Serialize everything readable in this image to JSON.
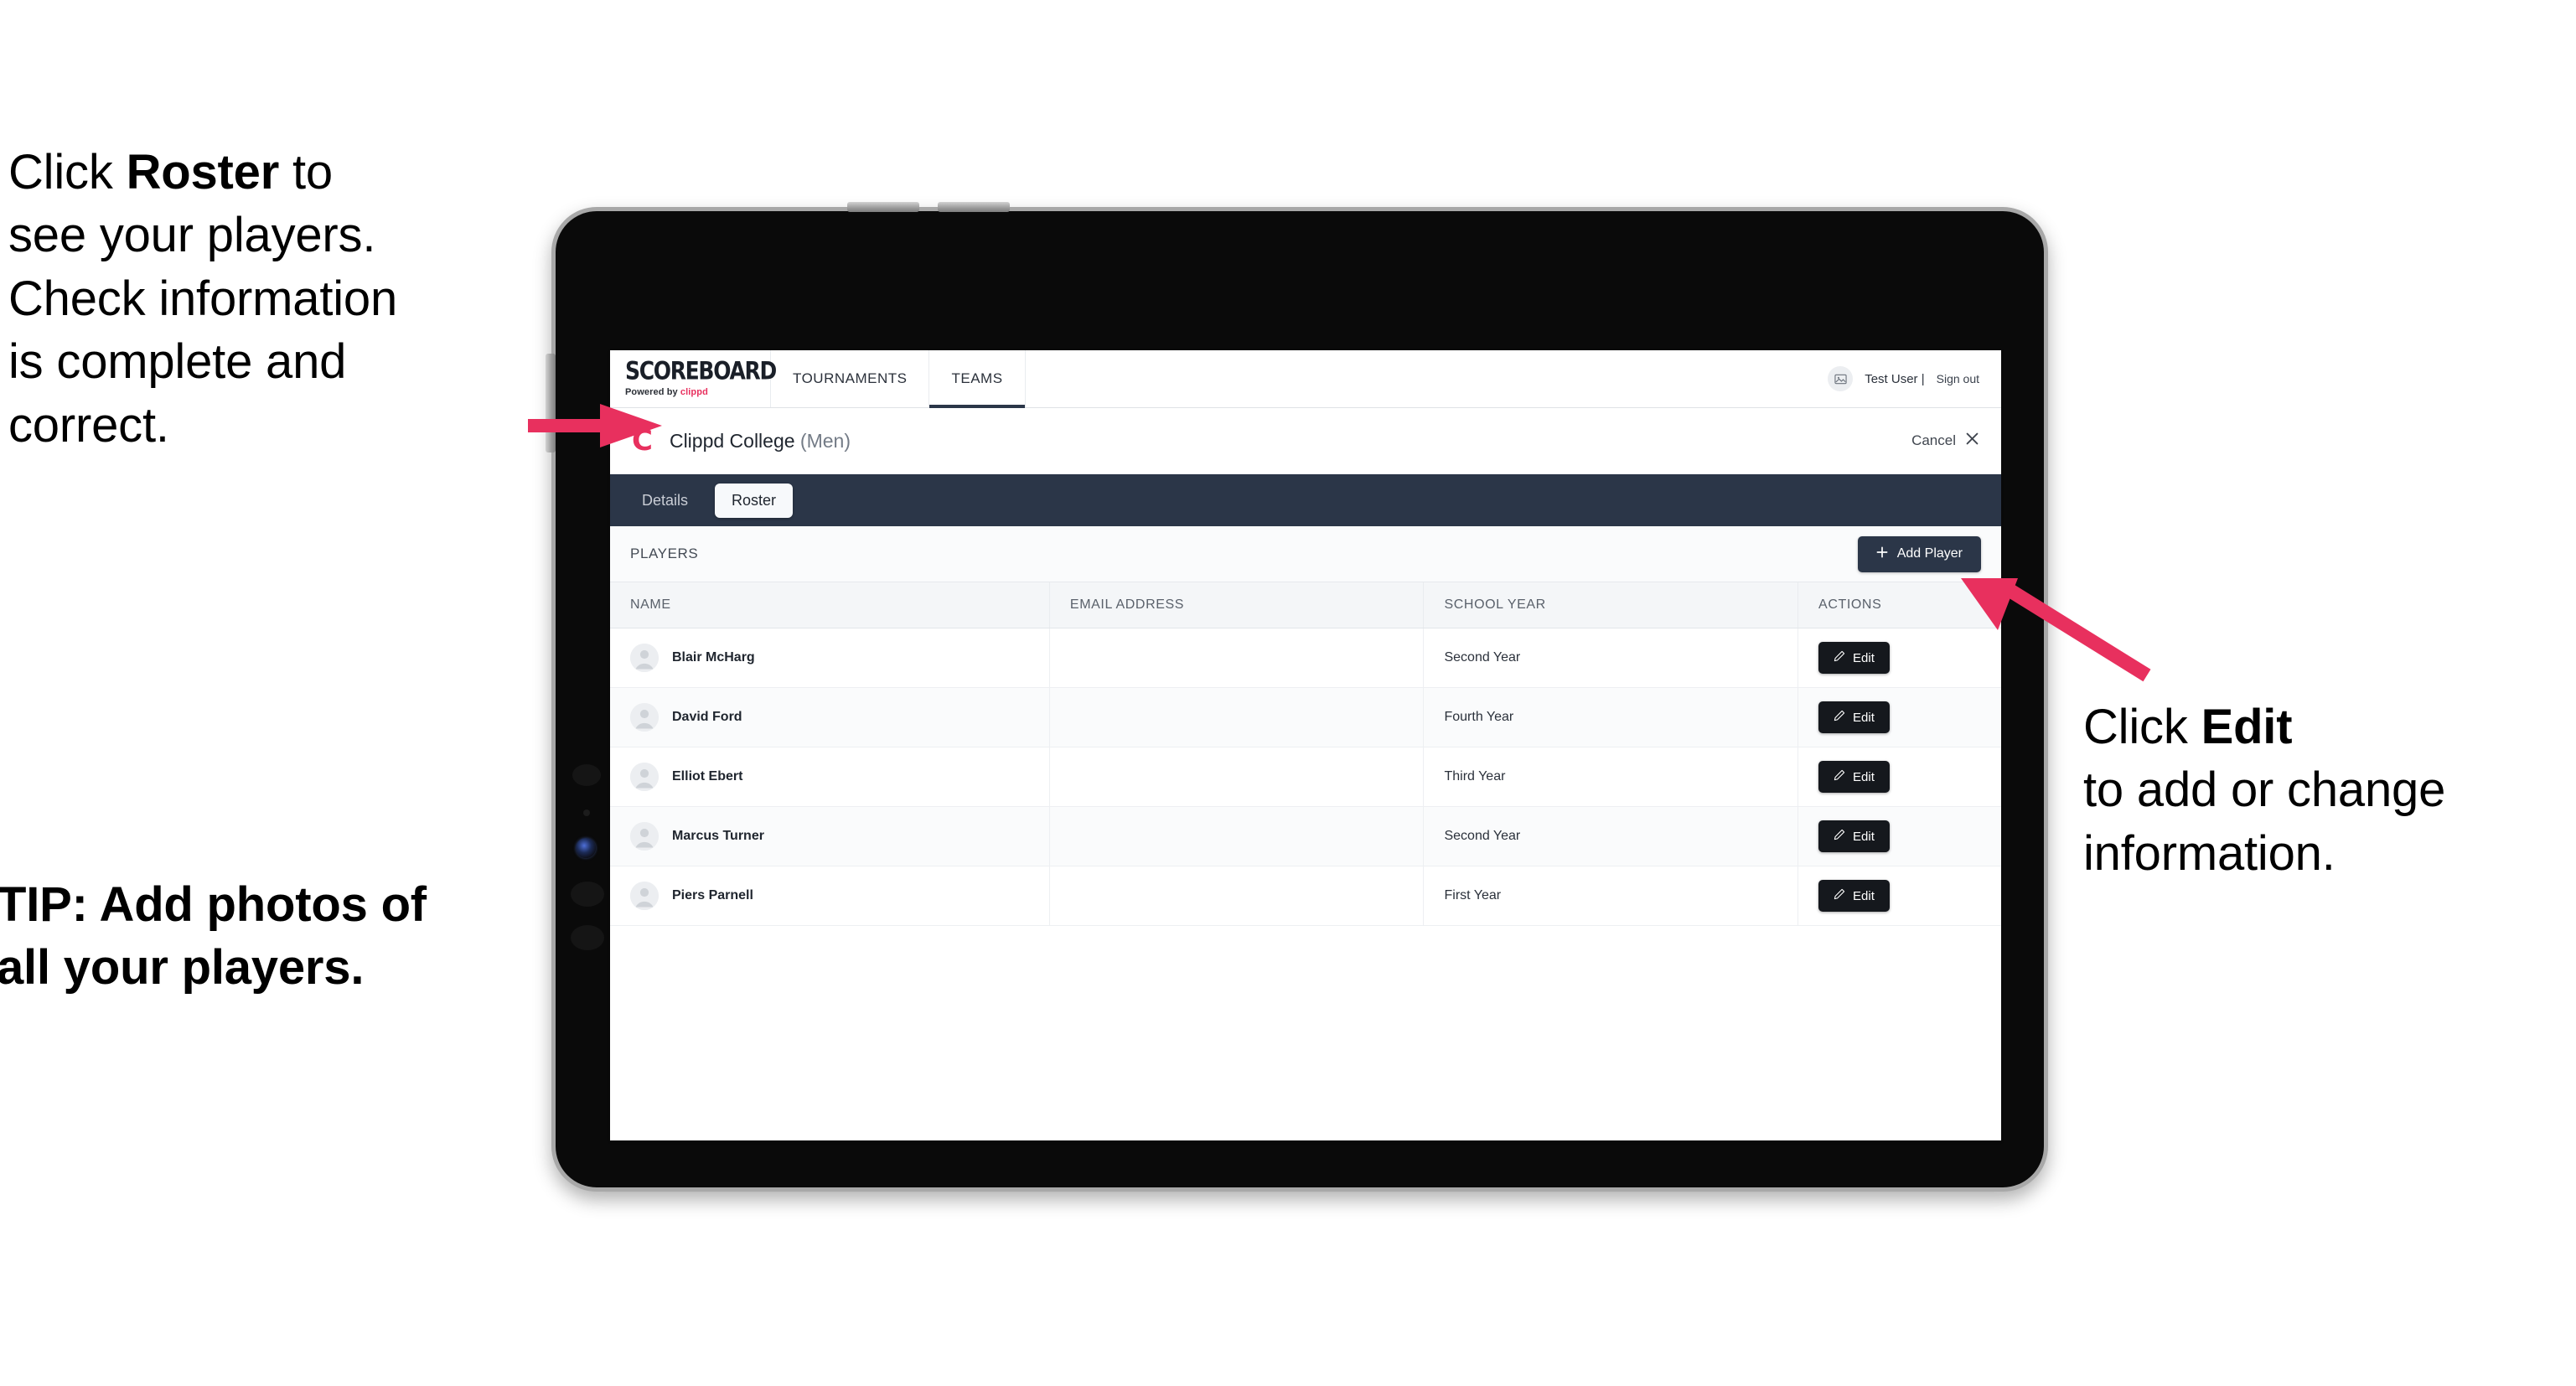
{
  "annotations": {
    "left_top": {
      "prefix": "Click ",
      "bold": "Roster",
      "suffix": " to\nsee your players.\nCheck information\nis complete and\ncorrect."
    },
    "left_bottom": {
      "text": "TIP: Add photos of\nall your players."
    },
    "right": {
      "prefix": "Click ",
      "bold": "Edit",
      "suffix": "\nto add or change\ninformation."
    },
    "arrow_color": "#e8305e"
  },
  "app": {
    "brand": {
      "title": "SCOREBOARD",
      "powered_prefix": "Powered by ",
      "powered_name": "clippd"
    },
    "topnav": [
      {
        "label": "TOURNAMENTS",
        "active": false
      },
      {
        "label": "TEAMS",
        "active": true
      }
    ],
    "user": {
      "avatar_icon": "broken-image-icon",
      "name": "Test User |",
      "sign_out": "Sign out"
    },
    "team_header": {
      "logo_letter": "C",
      "name": "Clippd College",
      "suffix": " (Men)",
      "cancel_label": "Cancel",
      "cancel_icon": "close-icon"
    },
    "tabs": [
      {
        "label": "Details",
        "active": false
      },
      {
        "label": "Roster",
        "active": true
      }
    ],
    "toolbar": {
      "section_label": "PLAYERS",
      "add_player_label": "Add Player",
      "add_player_icon": "plus-icon"
    },
    "table": {
      "columns": [
        "NAME",
        "EMAIL ADDRESS",
        "SCHOOL YEAR",
        "ACTIONS"
      ],
      "rows": [
        {
          "name": "Blair McHarg",
          "email": "",
          "school_year": "Second Year",
          "action_label": "Edit",
          "action_icon": "pencil-icon",
          "avatar_icon": "person-avatar-icon"
        },
        {
          "name": "David Ford",
          "email": "",
          "school_year": "Fourth Year",
          "action_label": "Edit",
          "action_icon": "pencil-icon",
          "avatar_icon": "person-avatar-icon"
        },
        {
          "name": "Elliot Ebert",
          "email": "",
          "school_year": "Third Year",
          "action_label": "Edit",
          "action_icon": "pencil-icon",
          "avatar_icon": "person-avatar-icon"
        },
        {
          "name": "Marcus Turner",
          "email": "",
          "school_year": "Second Year",
          "action_label": "Edit",
          "action_icon": "pencil-icon",
          "avatar_icon": "person-avatar-icon"
        },
        {
          "name": "Piers Parnell",
          "email": "",
          "school_year": "First Year",
          "action_label": "Edit",
          "action_icon": "pencil-icon",
          "avatar_icon": "person-avatar-icon"
        }
      ]
    },
    "colors": {
      "brand_pink": "#e8305e",
      "nav_dark": "#2b3648",
      "button_dark": "#15181d"
    }
  }
}
